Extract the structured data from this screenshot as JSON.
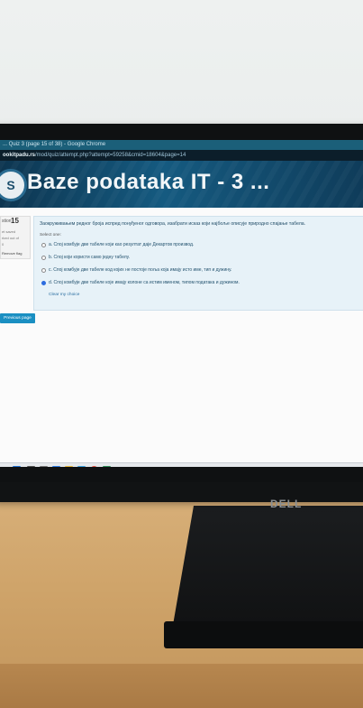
{
  "window": {
    "title_bar": "... Quiz 3 (page 15 of 38) - Google Chrome",
    "url_host": "ookitpadu.rs",
    "url_path": "/mod/quiz/attempt.php?attempt=59258&cmid=18604&page=14"
  },
  "header": {
    "logo_glyph": "S",
    "title": "Baze podataka IT - 3 ..."
  },
  "question_nav": {
    "label": "stion",
    "number": "15",
    "status_lines": [
      "et saved",
      "rked out of",
      "0"
    ],
    "flag_label": "Remove flag"
  },
  "question": {
    "prompt": "Заокруживањем редног броја испред понуђеног одговора, изабрати исказ који најбоље описује природно спајање табела.",
    "select_label": "Select one:",
    "options": [
      {
        "label": "a. Спој комбује две табеле који као резултат даје Декартов производ.",
        "selected": false
      },
      {
        "label": "b. Спој који користи само једну табелу.",
        "selected": false
      },
      {
        "label": "c. Спој комбује две табеле код којих не постоје поља која имају исто име, тип и дужину.",
        "selected": false
      },
      {
        "label": "d. Спој комбује две табеле које имају колоне са истим именом, типом података и дужином.",
        "selected": true
      }
    ],
    "clear_label": "Clear my choice"
  },
  "footer": {
    "prev_button": "Previous page"
  },
  "brand": {
    "monitor_logo": "DELL"
  },
  "colors": {
    "banner_bg": "#155a80",
    "question_bg": "#e7f2f8",
    "button_bg": "#1a8fc2"
  }
}
